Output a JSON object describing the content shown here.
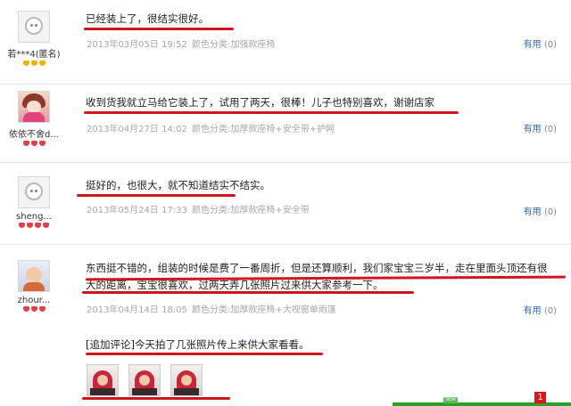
{
  "reviews": [
    {
      "user": "若***4(匿名)",
      "badge_type": "gold",
      "text": "已经装上了，很结实很好。",
      "date": "2013年03月05日 19:52",
      "spec": "颜色分类:加强款座椅",
      "useful_label": "有用",
      "useful_count": "(0)"
    },
    {
      "user": "依依不舍d...",
      "badge_type": "red",
      "text": "收到货我就立马给它装上了，试用了两天，很棒！儿子也特别喜欢，谢谢店家",
      "date": "2013年04月27日 14:02",
      "spec": "颜色分类:加厚款座椅+安全带+护网",
      "useful_label": "有用",
      "useful_count": "(0)"
    },
    {
      "user": "sheng...",
      "badge_type": "red",
      "text": "挺好的，也很大，就不知道结实不结实。",
      "date": "2013年05月24日 17:33",
      "spec": "颜色分类:加厚款座椅+安全带",
      "useful_label": "有用",
      "useful_count": "(0)"
    },
    {
      "user": "zhour...",
      "badge_type": "red",
      "text_line1": "东西挺不错的，组装的时候是费了一番周折，但是还算顺利，我们家宝宝三岁半，走在里面头顶还有很",
      "text_line2": "大的距离，宝宝很喜欢，过两天弄几张照片过来供大家参考一下。",
      "date": "2013年04月14日 18:05",
      "spec": "颜色分类:加厚款座椅+大视窗单雨篷",
      "useful_label": "有用",
      "useful_count": "(0)",
      "followup": "[追加评论]今天拍了几张照片传上来供大家看看。"
    }
  ],
  "page_badge": "1",
  "new_badge": "NEW",
  "colors": {
    "underline": "#d21420",
    "link": "#2d6cb5",
    "meta": "#a8a8a8"
  }
}
